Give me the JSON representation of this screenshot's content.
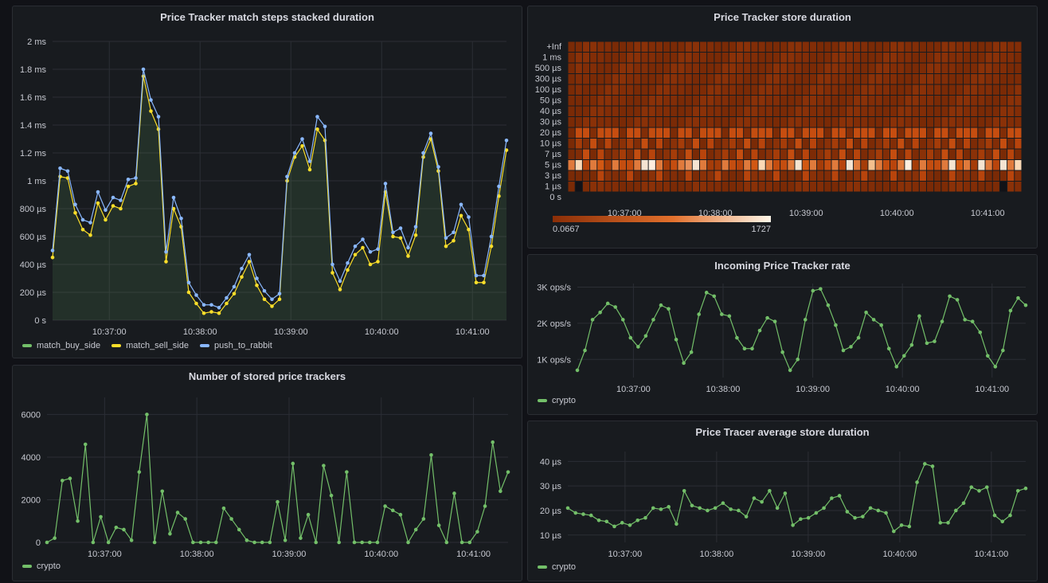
{
  "colors": {
    "green": "#73bf69",
    "yellow": "#fade2a",
    "blue": "#8ab8ff",
    "heat_low": "#8b2e07",
    "heat_high": "#fff6e8"
  },
  "panels": {
    "match": {
      "title": "Price Tracker match steps stacked duration",
      "legend": [
        "match_buy_side",
        "match_sell_side",
        "push_to_rabbit"
      ]
    },
    "heatmap": {
      "title": "Price Tracker store duration",
      "scale_min": "0.0667",
      "scale_max": "1727"
    },
    "rate": {
      "title": "Incoming Price Tracker rate",
      "legend": [
        "crypto"
      ]
    },
    "stored": {
      "title": "Number of stored price trackers",
      "legend": [
        "crypto"
      ]
    },
    "avg": {
      "title": "Price Tracer average store duration",
      "legend": [
        "crypto"
      ]
    }
  },
  "chart_data": [
    {
      "id": "match",
      "type": "line",
      "title": "Price Tracker match steps stacked duration",
      "y_ticks": [
        "0 s",
        "200 µs",
        "400 µs",
        "600 µs",
        "800 µs",
        "1 ms",
        "1.2 ms",
        "1.4 ms",
        "1.6 ms",
        "1.8 ms",
        "2 ms"
      ],
      "x_ticks": [
        "10:37:00",
        "10:38:00",
        "10:39:00",
        "10:40:00",
        "10:41:00"
      ],
      "ylim": [
        0,
        2
      ],
      "y_unit": "ms",
      "series": [
        {
          "name": "match_sell_side",
          "values": [
            0.45,
            1.03,
            1.02,
            0.77,
            0.65,
            0.61,
            0.84,
            0.72,
            0.82,
            0.8,
            0.96,
            0.98,
            1.75,
            1.5,
            1.37,
            0.42,
            0.8,
            0.67,
            0.2,
            0.12,
            0.05,
            0.06,
            0.05,
            0.12,
            0.19,
            0.31,
            0.42,
            0.25,
            0.15,
            0.1,
            0.15,
            1.0,
            1.17,
            1.25,
            1.08,
            1.37,
            1.29,
            0.34,
            0.22,
            0.36,
            0.47,
            0.52,
            0.4,
            0.42,
            0.92,
            0.6,
            0.59,
            0.46,
            0.61,
            1.17,
            1.3,
            1.07,
            0.53,
            0.57,
            0.75,
            0.65,
            0.27,
            0.27,
            0.53,
            0.89,
            1.22
          ]
        },
        {
          "name": "push_to_rabbit",
          "values": [
            0.5,
            1.09,
            1.07,
            0.83,
            0.72,
            0.7,
            0.92,
            0.79,
            0.88,
            0.86,
            1.01,
            1.02,
            1.8,
            1.58,
            1.46,
            0.49,
            0.88,
            0.73,
            0.27,
            0.18,
            0.11,
            0.11,
            0.09,
            0.16,
            0.24,
            0.37,
            0.47,
            0.3,
            0.21,
            0.15,
            0.19,
            1.03,
            1.2,
            1.3,
            1.14,
            1.46,
            1.39,
            0.4,
            0.28,
            0.41,
            0.53,
            0.58,
            0.49,
            0.51,
            0.98,
            0.63,
            0.66,
            0.52,
            0.67,
            1.2,
            1.34,
            1.1,
            0.59,
            0.63,
            0.83,
            0.74,
            0.32,
            0.32,
            0.6,
            0.96,
            1.29
          ]
        }
      ]
    },
    {
      "id": "heatmap",
      "type": "heatmap",
      "title": "Price Tracker store duration",
      "y_buckets": [
        "+Inf",
        "1 ms",
        "500 µs",
        "300 µs",
        "100 µs",
        "50 µs",
        "40 µs",
        "30 µs",
        "20 µs",
        "10 µs",
        "7 µs",
        "5 µs",
        "3 µs",
        "1 µs",
        "0 s"
      ],
      "x_ticks": [
        "10:37:00",
        "10:38:00",
        "10:39:00",
        "10:40:00",
        "10:41:00"
      ],
      "color_range": [
        0.0667,
        1727
      ]
    },
    {
      "id": "rate",
      "type": "line",
      "title": "Incoming Price Tracker rate",
      "y_ticks": [
        "1K ops/s",
        "2K ops/s",
        "3K ops/s"
      ],
      "x_ticks": [
        "10:37:00",
        "10:38:00",
        "10:39:00",
        "10:40:00",
        "10:41:00"
      ],
      "ylim": [
        500,
        3100
      ],
      "series": [
        {
          "name": "crypto",
          "values": [
            700,
            1250,
            2100,
            2300,
            2550,
            2450,
            2100,
            1600,
            1350,
            1650,
            2100,
            2500,
            2400,
            1550,
            900,
            1200,
            2250,
            2850,
            2750,
            2250,
            2200,
            1600,
            1300,
            1300,
            1800,
            2150,
            2050,
            1200,
            700,
            1000,
            2100,
            2900,
            2950,
            2500,
            1950,
            1250,
            1350,
            1600,
            2300,
            2100,
            1950,
            1300,
            800,
            1100,
            1400,
            2200,
            1450,
            1500,
            2050,
            2750,
            2650,
            2100,
            2050,
            1750,
            1100,
            800,
            1250,
            2350,
            2700,
            2500
          ]
        }
      ]
    },
    {
      "id": "stored",
      "type": "line",
      "title": "Number of stored price trackers",
      "y_ticks": [
        "0",
        "2000",
        "4000",
        "6000"
      ],
      "x_ticks": [
        "10:37:00",
        "10:38:00",
        "10:39:00",
        "10:40:00",
        "10:41:00"
      ],
      "ylim": [
        0,
        6800
      ],
      "series": [
        {
          "name": "crypto",
          "values": [
            0,
            200,
            2900,
            3000,
            1000,
            4600,
            0,
            1200,
            0,
            700,
            600,
            100,
            3300,
            6000,
            0,
            2400,
            400,
            1400,
            1100,
            0,
            0,
            0,
            0,
            1600,
            1100,
            600,
            100,
            0,
            0,
            0,
            1900,
            100,
            3700,
            200,
            1300,
            0,
            3600,
            2200,
            0,
            3300,
            0,
            0,
            0,
            0,
            1700,
            1500,
            1300,
            0,
            600,
            1100,
            4100,
            800,
            0,
            2300,
            0,
            0,
            500,
            1700,
            4700,
            2400,
            3300
          ]
        }
      ]
    },
    {
      "id": "avg",
      "type": "line",
      "title": "Price Tracer average store duration",
      "y_ticks": [
        "10 µs",
        "20 µs",
        "30 µs",
        "40 µs"
      ],
      "x_ticks": [
        "10:37:00",
        "10:38:00",
        "10:39:00",
        "10:40:00",
        "10:41:00"
      ],
      "ylim": [
        7,
        44
      ],
      "series": [
        {
          "name": "crypto",
          "values": [
            21,
            19,
            18.5,
            18,
            16,
            15.5,
            13.5,
            15,
            14,
            16,
            17,
            21,
            20.5,
            21.5,
            14.5,
            28,
            22,
            21,
            20,
            21,
            23,
            20.5,
            20,
            17.5,
            25,
            23.5,
            28,
            21,
            27,
            14,
            16.5,
            17,
            19,
            21,
            25,
            26,
            19.5,
            17,
            17.5,
            21,
            20,
            19,
            11.5,
            14,
            13.5,
            31.5,
            39,
            38,
            15,
            15,
            20,
            23,
            29.5,
            28,
            29.5,
            18,
            15.5,
            18,
            28,
            29
          ]
        }
      ]
    }
  ]
}
